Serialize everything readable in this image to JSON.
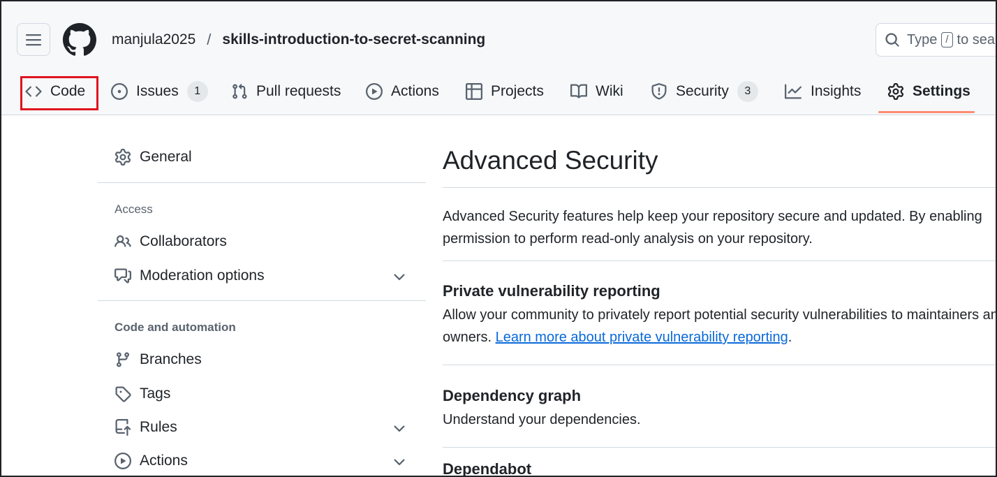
{
  "header": {
    "owner": "manjula2025",
    "separator": "/",
    "repo": "skills-introduction-to-secret-scanning",
    "search_prefix": "Type",
    "search_key": "/",
    "search_suffix": "to search"
  },
  "tabs": [
    {
      "label": "Code",
      "icon": "code-icon"
    },
    {
      "label": "Issues",
      "count": "1",
      "icon": "issue-opened-icon"
    },
    {
      "label": "Pull requests",
      "icon": "git-pull-request-icon"
    },
    {
      "label": "Actions",
      "icon": "play-icon"
    },
    {
      "label": "Projects",
      "icon": "table-icon"
    },
    {
      "label": "Wiki",
      "icon": "book-icon"
    },
    {
      "label": "Security",
      "count": "3",
      "icon": "shield-icon"
    },
    {
      "label": "Insights",
      "icon": "graph-icon"
    },
    {
      "label": "Settings",
      "icon": "gear-icon",
      "selected": true
    }
  ],
  "sidebar": {
    "general": "General",
    "access_heading": "Access",
    "collaborators": "Collaborators",
    "moderation": "Moderation options",
    "code_heading": "Code and automation",
    "branches": "Branches",
    "tags": "Tags",
    "rules": "Rules",
    "actions": "Actions"
  },
  "main": {
    "title": "Advanced Security",
    "intro_line1": "Advanced Security features help keep your repository secure and updated. By enabling",
    "intro_line2": "permission to perform read-only analysis on your repository.",
    "pvr_title": "Private vulnerability reporting",
    "pvr_line1": "Allow your community to privately report potential security vulnerabilities to maintainers and",
    "pvr_line2_prefix": "owners.",
    "pvr_link": "Learn more about private vulnerability reporting",
    "pvr_line2_suffix": ".",
    "dep_graph_title": "Dependency graph",
    "dep_graph_desc": "Understand your dependencies.",
    "dependabot_title": "Dependabot"
  },
  "colors": {
    "accent_underline": "#fd8c73",
    "link": "#0969da",
    "highlight": "#e0141e"
  }
}
